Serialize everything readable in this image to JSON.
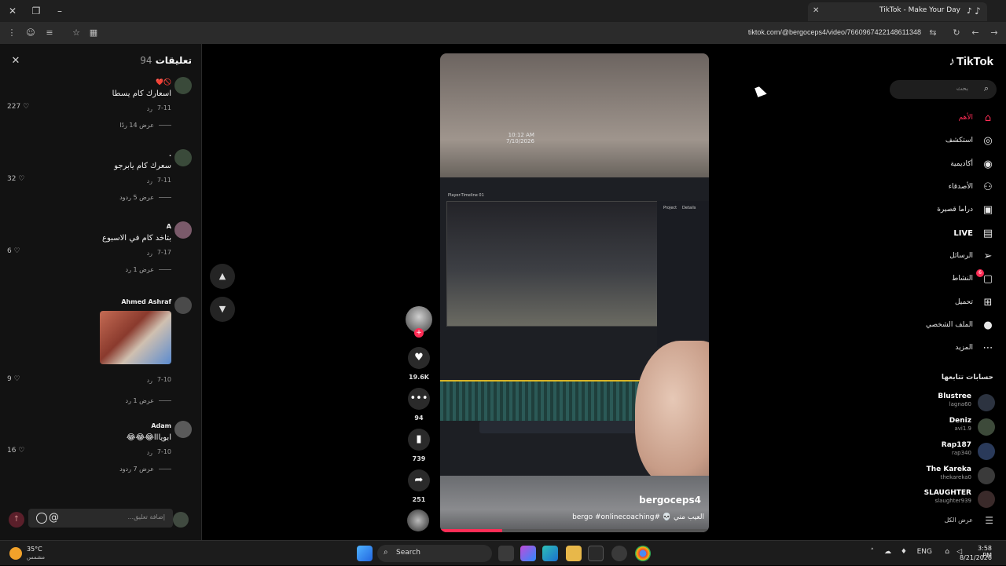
{
  "browser": {
    "tab_title": "TikTok - Make Your Day",
    "url": "tiktok.com/@bergoceps4/video/7660967422148611348"
  },
  "comments": {
    "title": "تعليقات",
    "count": "94",
    "input_placeholder": "إضافة تعليق...",
    "at_symbol": "@",
    "items": [
      {
        "user": "🚫❤️",
        "text": "اسعارك كام يسطا",
        "date": "7-11",
        "reply": "رد",
        "likes": "227",
        "view_replies": "عرض 14 ردًا"
      },
      {
        "user": ".",
        "text": "سعرك كام يابرجو",
        "date": "7-11",
        "reply": "رد",
        "likes": "32",
        "view_replies": "عرض 5 ردود"
      },
      {
        "user": "A",
        "text": "بتاخد كام في الاسبوع",
        "date": "7-17",
        "reply": "رد",
        "likes": "6",
        "view_replies": "عرض 1 رد"
      },
      {
        "user": "Ahmed Ashraf",
        "text": "",
        "date": "7-10",
        "reply": "رد",
        "likes": "9",
        "view_replies": "عرض 1 رد"
      },
      {
        "user": "Adam",
        "text": "ابويااا😂😂😂",
        "date": "7-10",
        "reply": "رد",
        "likes": "16",
        "view_replies": "عرض 7 ردود"
      }
    ]
  },
  "video": {
    "author": "bergoceps4",
    "caption": "العيب مني 💀 #bergo #onlinecoaching",
    "overlay_time": "10:12 AM",
    "overlay_date": "7/10/2026",
    "progress": 0.23,
    "player_title": "Player-Timeline 01",
    "panel_tabs": [
      "Project",
      "Details"
    ]
  },
  "actions": {
    "likes": "19.6K",
    "comments": "94",
    "saves": "739",
    "shares": "251"
  },
  "nav": {
    "logo": "TikTok",
    "search_placeholder": "بحث",
    "items": [
      {
        "label": "الأهم",
        "icon": "home-icon",
        "glyph": "⌂",
        "active": true
      },
      {
        "label": "استكشف",
        "icon": "compass-icon",
        "glyph": "◎"
      },
      {
        "label": "أكاديمية",
        "icon": "academy-icon",
        "glyph": "◉"
      },
      {
        "label": "الأصدقاء",
        "icon": "friends-icon",
        "glyph": "⚇"
      },
      {
        "label": "دراما قصيرة",
        "icon": "drama-icon",
        "glyph": "▣"
      },
      {
        "label": "LIVE",
        "icon": "live-icon",
        "glyph": "▤",
        "bold": true
      },
      {
        "label": "الرسائل",
        "icon": "messages-icon",
        "glyph": "➢"
      },
      {
        "label": "النشاط",
        "icon": "activity-icon",
        "glyph": "▢",
        "badge": "6"
      },
      {
        "label": "تحميل",
        "icon": "upload-icon",
        "glyph": "⊞"
      },
      {
        "label": "الملف الشخصي",
        "icon": "profile-icon",
        "glyph": "●"
      },
      {
        "label": "المزيد",
        "icon": "more-icon",
        "glyph": "⋯"
      }
    ],
    "following_title": "حسابات تتابعها",
    "accounts": [
      {
        "name": "Blustree",
        "handle": "lagna60"
      },
      {
        "name": "Deniz",
        "handle": "avi1.9"
      },
      {
        "name": "Rap187",
        "handle": "rap340"
      },
      {
        "name": "The Kareka",
        "handle": "thekareka0"
      },
      {
        "name": "SLAUGHTER",
        "handle": "slaughter939"
      }
    ],
    "see_all": "عرض الكل"
  },
  "taskbar": {
    "temp": "35°C",
    "condition": "مشمس",
    "search": "Search",
    "lang": "ENG",
    "time": "3:58 PM",
    "date": "8/21/2026"
  },
  "colors": {
    "accent": "#fe2c55",
    "brand_bg": "#000000"
  }
}
